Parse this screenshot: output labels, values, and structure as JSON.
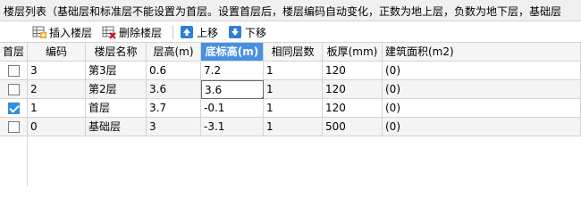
{
  "info": {
    "text": "楼层列表（基础层和标准层不能设置为首层。设置首层后，楼层编码自动变化，正数为地上层，负数为地下层，基础层"
  },
  "toolbar": {
    "insert_label": "插入楼层",
    "delete_label": "删除楼层",
    "up_label": "上移",
    "down_label": "下移"
  },
  "table": {
    "columns": [
      "首层",
      "编码",
      "楼层名称",
      "层高(m)",
      "底标高(m)",
      "相同层数",
      "板厚(mm)",
      "建筑面积(m2)"
    ],
    "active_column": "底标高(m)",
    "rows": [
      {
        "first_floor": false,
        "code": "3",
        "name": "第3层",
        "height": "0.6",
        "base_elev": "7.2",
        "same_count": "1",
        "slab": "120",
        "area": "(0)"
      },
      {
        "first_floor": false,
        "code": "2",
        "name": "第2层",
        "height": "3.6",
        "base_elev": "3.6",
        "same_count": "1",
        "slab": "120",
        "area": "(0)"
      },
      {
        "first_floor": true,
        "code": "1",
        "name": "首层",
        "height": "3.7",
        "base_elev": "-0.1",
        "same_count": "1",
        "slab": "120",
        "area": "(0)"
      },
      {
        "first_floor": false,
        "code": "0",
        "name": "基础层",
        "height": "3",
        "base_elev": "-3.1",
        "same_count": "1",
        "slab": "500",
        "area": "(0)"
      }
    ]
  },
  "colors": {
    "active_header": "#4a90e2",
    "checkbox_checked": "#2f8fe0"
  },
  "icons": {
    "insert": "insert-floor-icon",
    "delete": "delete-floor-icon",
    "up": "arrow-up-icon",
    "down": "arrow-down-icon"
  }
}
